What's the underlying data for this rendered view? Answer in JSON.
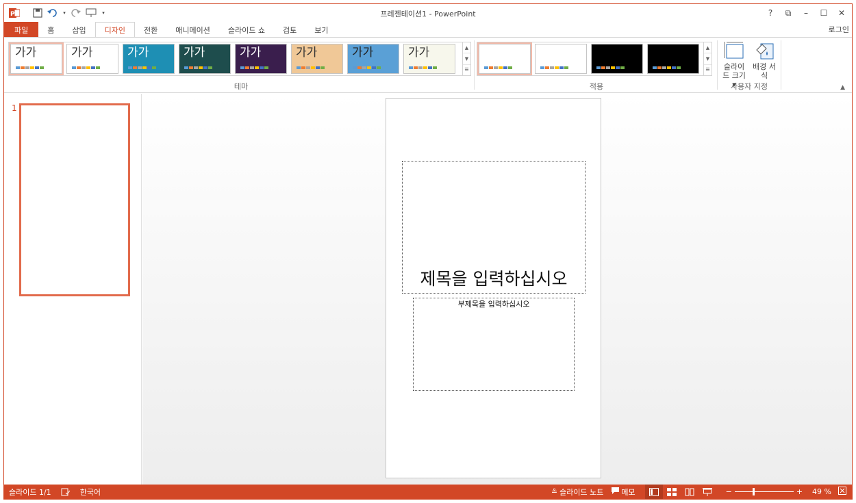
{
  "app": {
    "title": "프레젠테이션1 - PowerPoint",
    "login": "로그인"
  },
  "window_controls": {
    "help": "?",
    "ribbon_display": "⧉",
    "minimize": "–",
    "maximize": "☐",
    "close": "✕"
  },
  "tabs": [
    "파일",
    "홈",
    "삽입",
    "디자인",
    "전환",
    "애니메이션",
    "슬라이드 쇼",
    "검토",
    "보기"
  ],
  "active_tab": "디자인",
  "ribbon": {
    "themes": {
      "label": "테마",
      "items": [
        {
          "text": "가가",
          "bg": "#ffffff",
          "fg": "#333333",
          "selected": true
        },
        {
          "text": "가가",
          "bg": "#ffffff",
          "fg": "#333333",
          "selected": false
        },
        {
          "text": "가가",
          "bg": "#1e8fb4",
          "fg": "#ffffff",
          "selected": false
        },
        {
          "text": "가가",
          "bg": "#1e4d4d",
          "fg": "#ffffff",
          "selected": false
        },
        {
          "text": "가가",
          "bg": "#3a1e4d",
          "fg": "#ffffff",
          "selected": false
        },
        {
          "text": "가가",
          "bg": "#f0c897",
          "fg": "#333333",
          "selected": false
        },
        {
          "text": "가가",
          "bg": "#5aa0d6",
          "fg": "#222222",
          "selected": false
        },
        {
          "text": "가가",
          "bg": "#f7f7ec",
          "fg": "#333333",
          "selected": false
        }
      ]
    },
    "variants": {
      "label": "적용",
      "items": [
        {
          "bg": "#ffffff",
          "selected": true
        },
        {
          "bg": "#ffffff",
          "selected": false
        },
        {
          "bg": "#000000",
          "selected": false
        },
        {
          "bg": "#000000",
          "selected": false
        }
      ]
    },
    "customize": {
      "label": "사용자 지정",
      "slide_size": "슬라이드 크기 ▾",
      "background_format": "배경 서식"
    }
  },
  "slides_pane": {
    "slide_number": "1"
  },
  "slide": {
    "title_placeholder": "제목을 입력하십시오",
    "subtitle_placeholder": "부제목을 입력하십시오"
  },
  "statusbar": {
    "slide_position": "슬라이드 1/1",
    "language": "한국어",
    "notes": "슬라이드 노트",
    "comments": "메모",
    "zoom": "49 %",
    "zoom_fraction": 0.3
  },
  "colors": {
    "accent": "#d24726"
  }
}
